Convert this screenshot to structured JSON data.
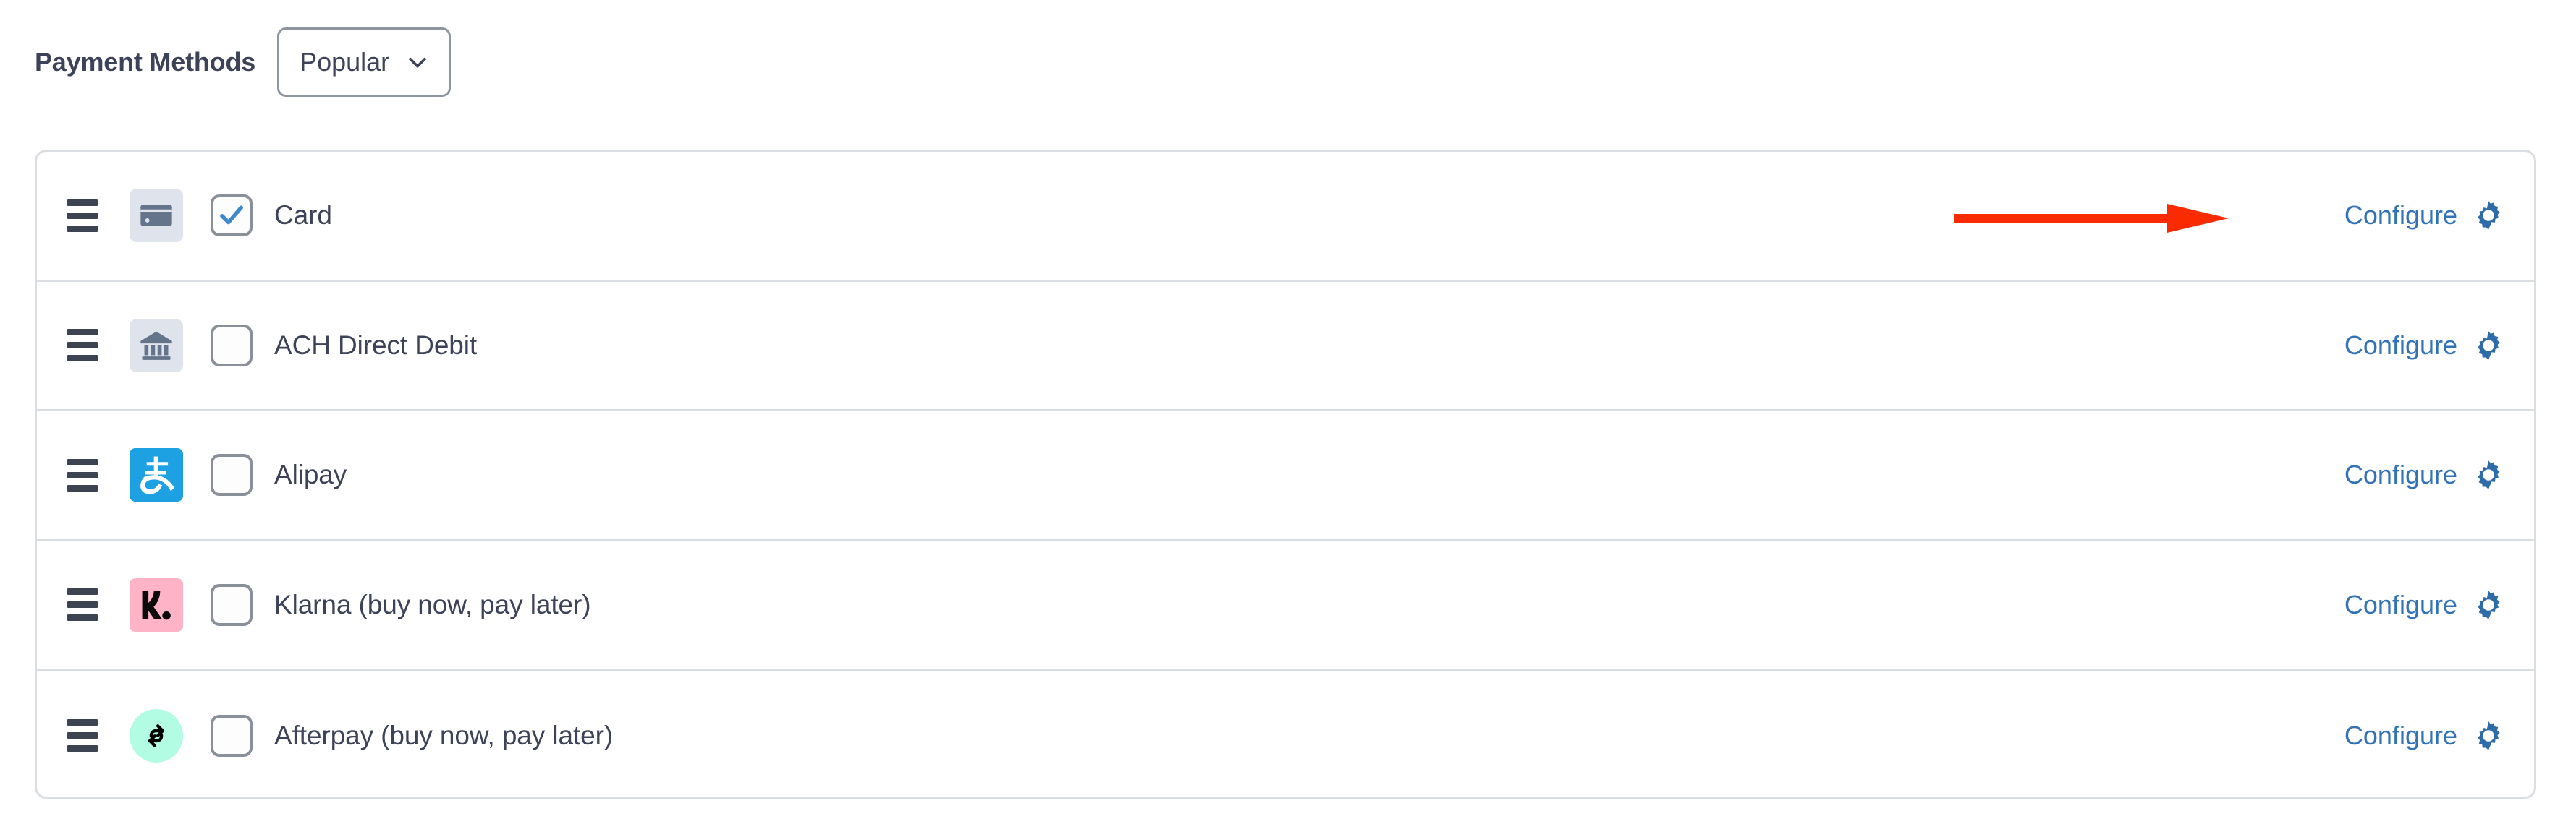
{
  "header": {
    "title": "Payment Methods",
    "filter": {
      "name": "popular-filter-dropdown",
      "selected": "Popular",
      "icon": "chevron-down-icon"
    }
  },
  "colors": {
    "text_primary": "#3c4257",
    "link_blue": "#3273b8",
    "gear_blue": "#2d6ca8",
    "checkbox_check": "#3e88cc",
    "card_border": "#dadee3",
    "tile_generic": "#dfe3ec",
    "tile_alipay": "#1da1e2",
    "tile_klarna": "#ffb3c7",
    "tile_afterpay": "#b2fce4",
    "annotation_red": "#fa2b00"
  },
  "payment_methods": {
    "row_action_label": "Configure",
    "row_action_icon": "gear-icon",
    "drag_icon": "drag-handle-icon",
    "rows": [
      {
        "label": "Card",
        "icon": "credit-card-icon",
        "tile": "generic",
        "checked": true,
        "configure_label": "Configure"
      },
      {
        "label": "ACH Direct Debit",
        "icon": "bank-building-icon",
        "tile": "generic",
        "checked": false,
        "configure_label": "Configure"
      },
      {
        "label": "Alipay",
        "icon": "alipay-logo-icon",
        "tile": "alipay",
        "checked": false,
        "configure_label": "Configure"
      },
      {
        "label": "Klarna (buy now, pay later)",
        "icon": "klarna-logo-icon",
        "tile": "klarna",
        "checked": false,
        "configure_label": "Configure"
      },
      {
        "label": "Afterpay (buy now, pay later)",
        "icon": "afterpay-logo-icon",
        "tile": "afterpay",
        "checked": false,
        "configure_label": "Configure"
      }
    ]
  },
  "annotation": {
    "type": "arrow",
    "direction": "right",
    "target": "Configure",
    "color": "#fa2b00"
  }
}
